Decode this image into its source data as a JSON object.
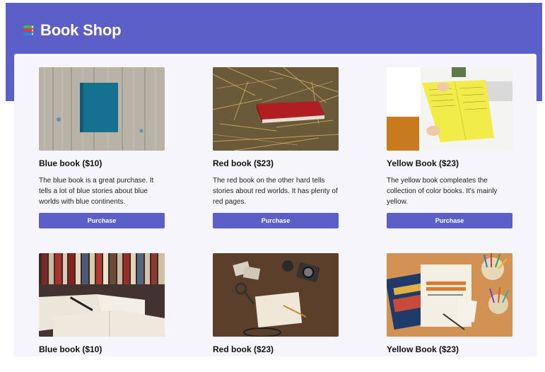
{
  "header": {
    "title": "Book Shop",
    "icon": "books-icon",
    "color": "#5b5fc7"
  },
  "books": [
    {
      "title": "Blue book ($10)",
      "description": "The blue book is a great purchase. It tells a lot of blue stories about blue worlds with blue continents.",
      "button": "Purchase",
      "image": "blue-notebook-on-wood-image"
    },
    {
      "title": "Red book ($23)",
      "description": "The red book on the other hard tells stories about red worlds. It has plenty of red pages.",
      "button": "Purchase",
      "image": "red-book-in-straw-image"
    },
    {
      "title": "Yellow Book ($23)",
      "description": "The yellow book compleates the collection of color books. It's mainly yellow.",
      "button": "Purchase",
      "image": "yellow-pages-book-image"
    },
    {
      "title": "Blue book ($10)",
      "image": "open-book-library-image"
    },
    {
      "title": "Red book ($23)",
      "image": "travel-desk-image"
    },
    {
      "title": "Yellow Book ($23)",
      "image": "math-books-desk-image"
    }
  ]
}
